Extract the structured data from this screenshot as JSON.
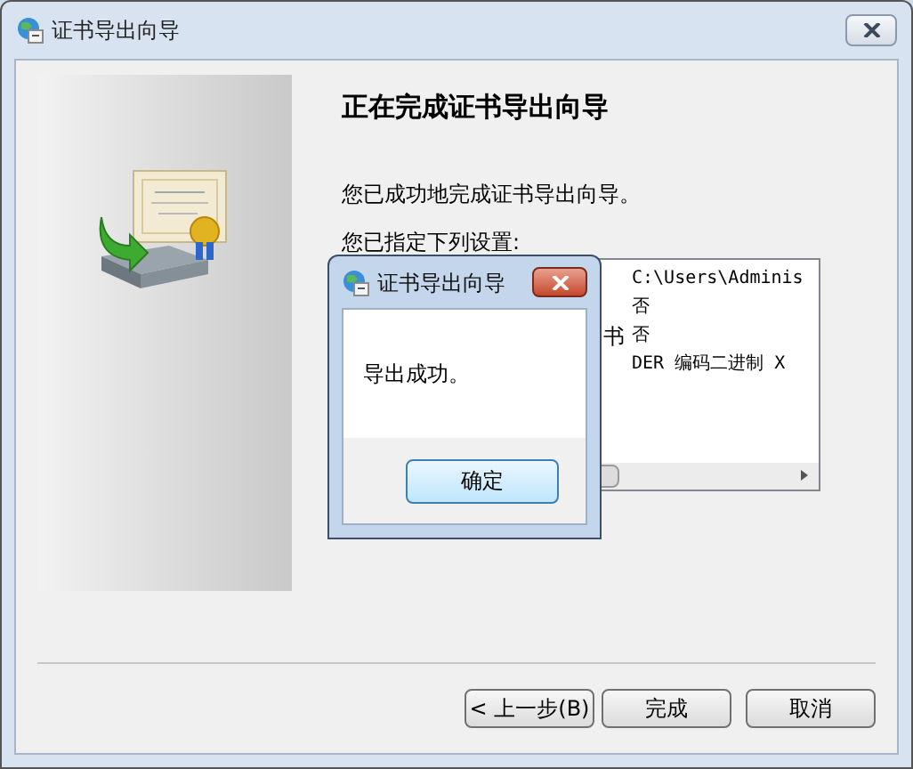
{
  "window": {
    "title": "证书导出向导"
  },
  "heading": "正在完成证书导出向导",
  "message": "您已成功地完成证书导出向导。",
  "settings_label": "您已指定下列设置:",
  "settings": {
    "column_1": [
      "书"
    ],
    "column_2": [
      "C:\\Users\\Adminis",
      "否",
      "否",
      "DER 编码二进制 X"
    ]
  },
  "buttons": [
    "< 上一步(B)",
    "完成",
    "取消"
  ],
  "dialog": {
    "title": "证书导出向导",
    "message": "导出成功。",
    "button": "确定"
  }
}
